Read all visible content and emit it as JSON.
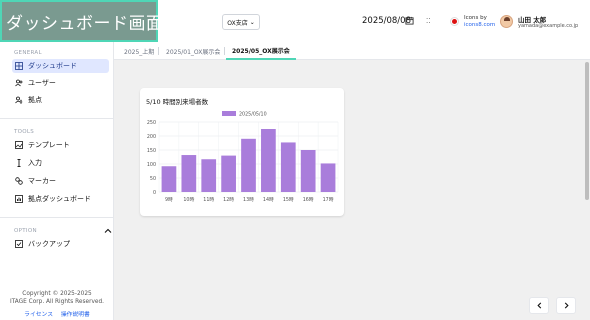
{
  "header": {
    "title": "ダッシュボード画面",
    "store_select": "OX支店",
    "date": "2025/08/08",
    "icons_by": "Icons by",
    "icons_link": "icons8.com",
    "user_name": "山田 太郎",
    "user_email": "yamada@example.co.jp"
  },
  "sidebar": {
    "general_label": "GENERAL",
    "general_items": [
      {
        "label": "ダッシュボード",
        "icon": "dashboard-icon",
        "active": true
      },
      {
        "label": "ユーザー",
        "icon": "users-icon"
      },
      {
        "label": "拠点",
        "icon": "location-users-icon"
      }
    ],
    "tools_label": "TOOLS",
    "tools_items": [
      {
        "label": "テンプレート",
        "icon": "template-icon"
      },
      {
        "label": "入力",
        "icon": "text-cursor-icon"
      },
      {
        "label": "マーカー",
        "icon": "link-icon"
      },
      {
        "label": "拠点ダッシュボード",
        "icon": "chart-icon"
      }
    ],
    "option_label": "OPTION",
    "option_items": [
      {
        "label": "バックアップ",
        "icon": "backup-icon"
      }
    ],
    "copyright_line1": "Copyright © 2025-2025",
    "copyright_line2": "ITAGE Corp. All Rights Reserved.",
    "link_license": "ライセンス",
    "link_manual": "操作説明書"
  },
  "tabs": [
    {
      "label": "2025_上期"
    },
    {
      "label": "2025/01_OX展示会"
    },
    {
      "label": "2025/05_OX展示会",
      "active": true
    }
  ],
  "chart_data": {
    "type": "bar",
    "title": "5/10 時間別来場者数",
    "series": [
      {
        "name": "2025/05/10",
        "values": [
          92,
          132,
          117,
          130,
          190,
          225,
          177,
          150,
          102
        ]
      }
    ],
    "categories": [
      "9時",
      "10時",
      "11時",
      "12時",
      "13時",
      "14時",
      "15時",
      "16時",
      "17時"
    ],
    "ylim": [
      0,
      250
    ],
    "yticks": [
      0,
      50,
      100,
      150,
      200,
      250
    ],
    "legend": "top",
    "grid": true,
    "bar_color": "#a97ddb"
  }
}
